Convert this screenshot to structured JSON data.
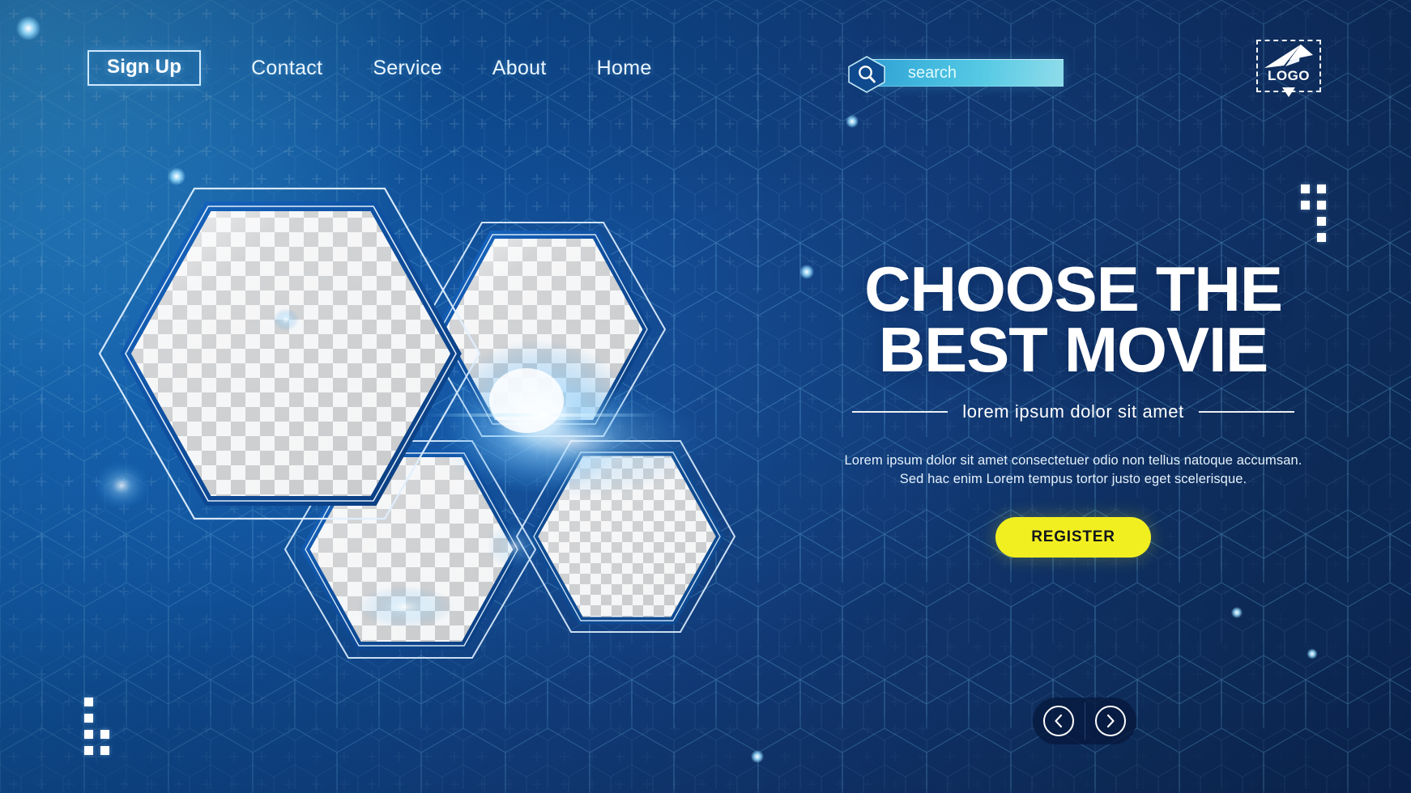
{
  "theme": {
    "bg_deep": "#0b2450",
    "bg_mid": "#10529d",
    "bg_bright": "#1a7fd4",
    "accent_cyan": "#55c9e4",
    "accent_yellow": "#f2ef21",
    "text_white": "#ffffff"
  },
  "nav": {
    "signup_label": "Sign Up",
    "links": [
      {
        "id": "contact",
        "label": "Contact"
      },
      {
        "id": "service",
        "label": "Service"
      },
      {
        "id": "about",
        "label": "About"
      },
      {
        "id": "home",
        "label": "Home"
      }
    ]
  },
  "search": {
    "placeholder": "search",
    "value": "",
    "icon": "search-icon"
  },
  "logo": {
    "text": "LOGO",
    "mark_icon": "paper-plane-icon",
    "caret_icon": "triangle-down-icon"
  },
  "hero": {
    "headline_line1": "CHOOSE THE",
    "headline_line2": "BEST MOVIE",
    "subtitle": "lorem ipsum dolor sit amet",
    "body": "Lorem ipsum dolor sit amet consectetuer odio non tellus natoque accumsan. Sed hac enim Lorem tempus tortor justo eget scelerisque.",
    "cta_label": "REGISTER"
  },
  "carousel": {
    "prev_icon": "chevron-left-icon",
    "next_icon": "chevron-right-icon"
  },
  "media": {
    "placeholders": [
      {
        "id": "hex-large",
        "label": "image-placeholder-1"
      },
      {
        "id": "hex-top-right",
        "label": "image-placeholder-2"
      },
      {
        "id": "hex-bottom-middle",
        "label": "image-placeholder-3"
      },
      {
        "id": "hex-bottom-right",
        "label": "image-placeholder-4"
      }
    ]
  }
}
